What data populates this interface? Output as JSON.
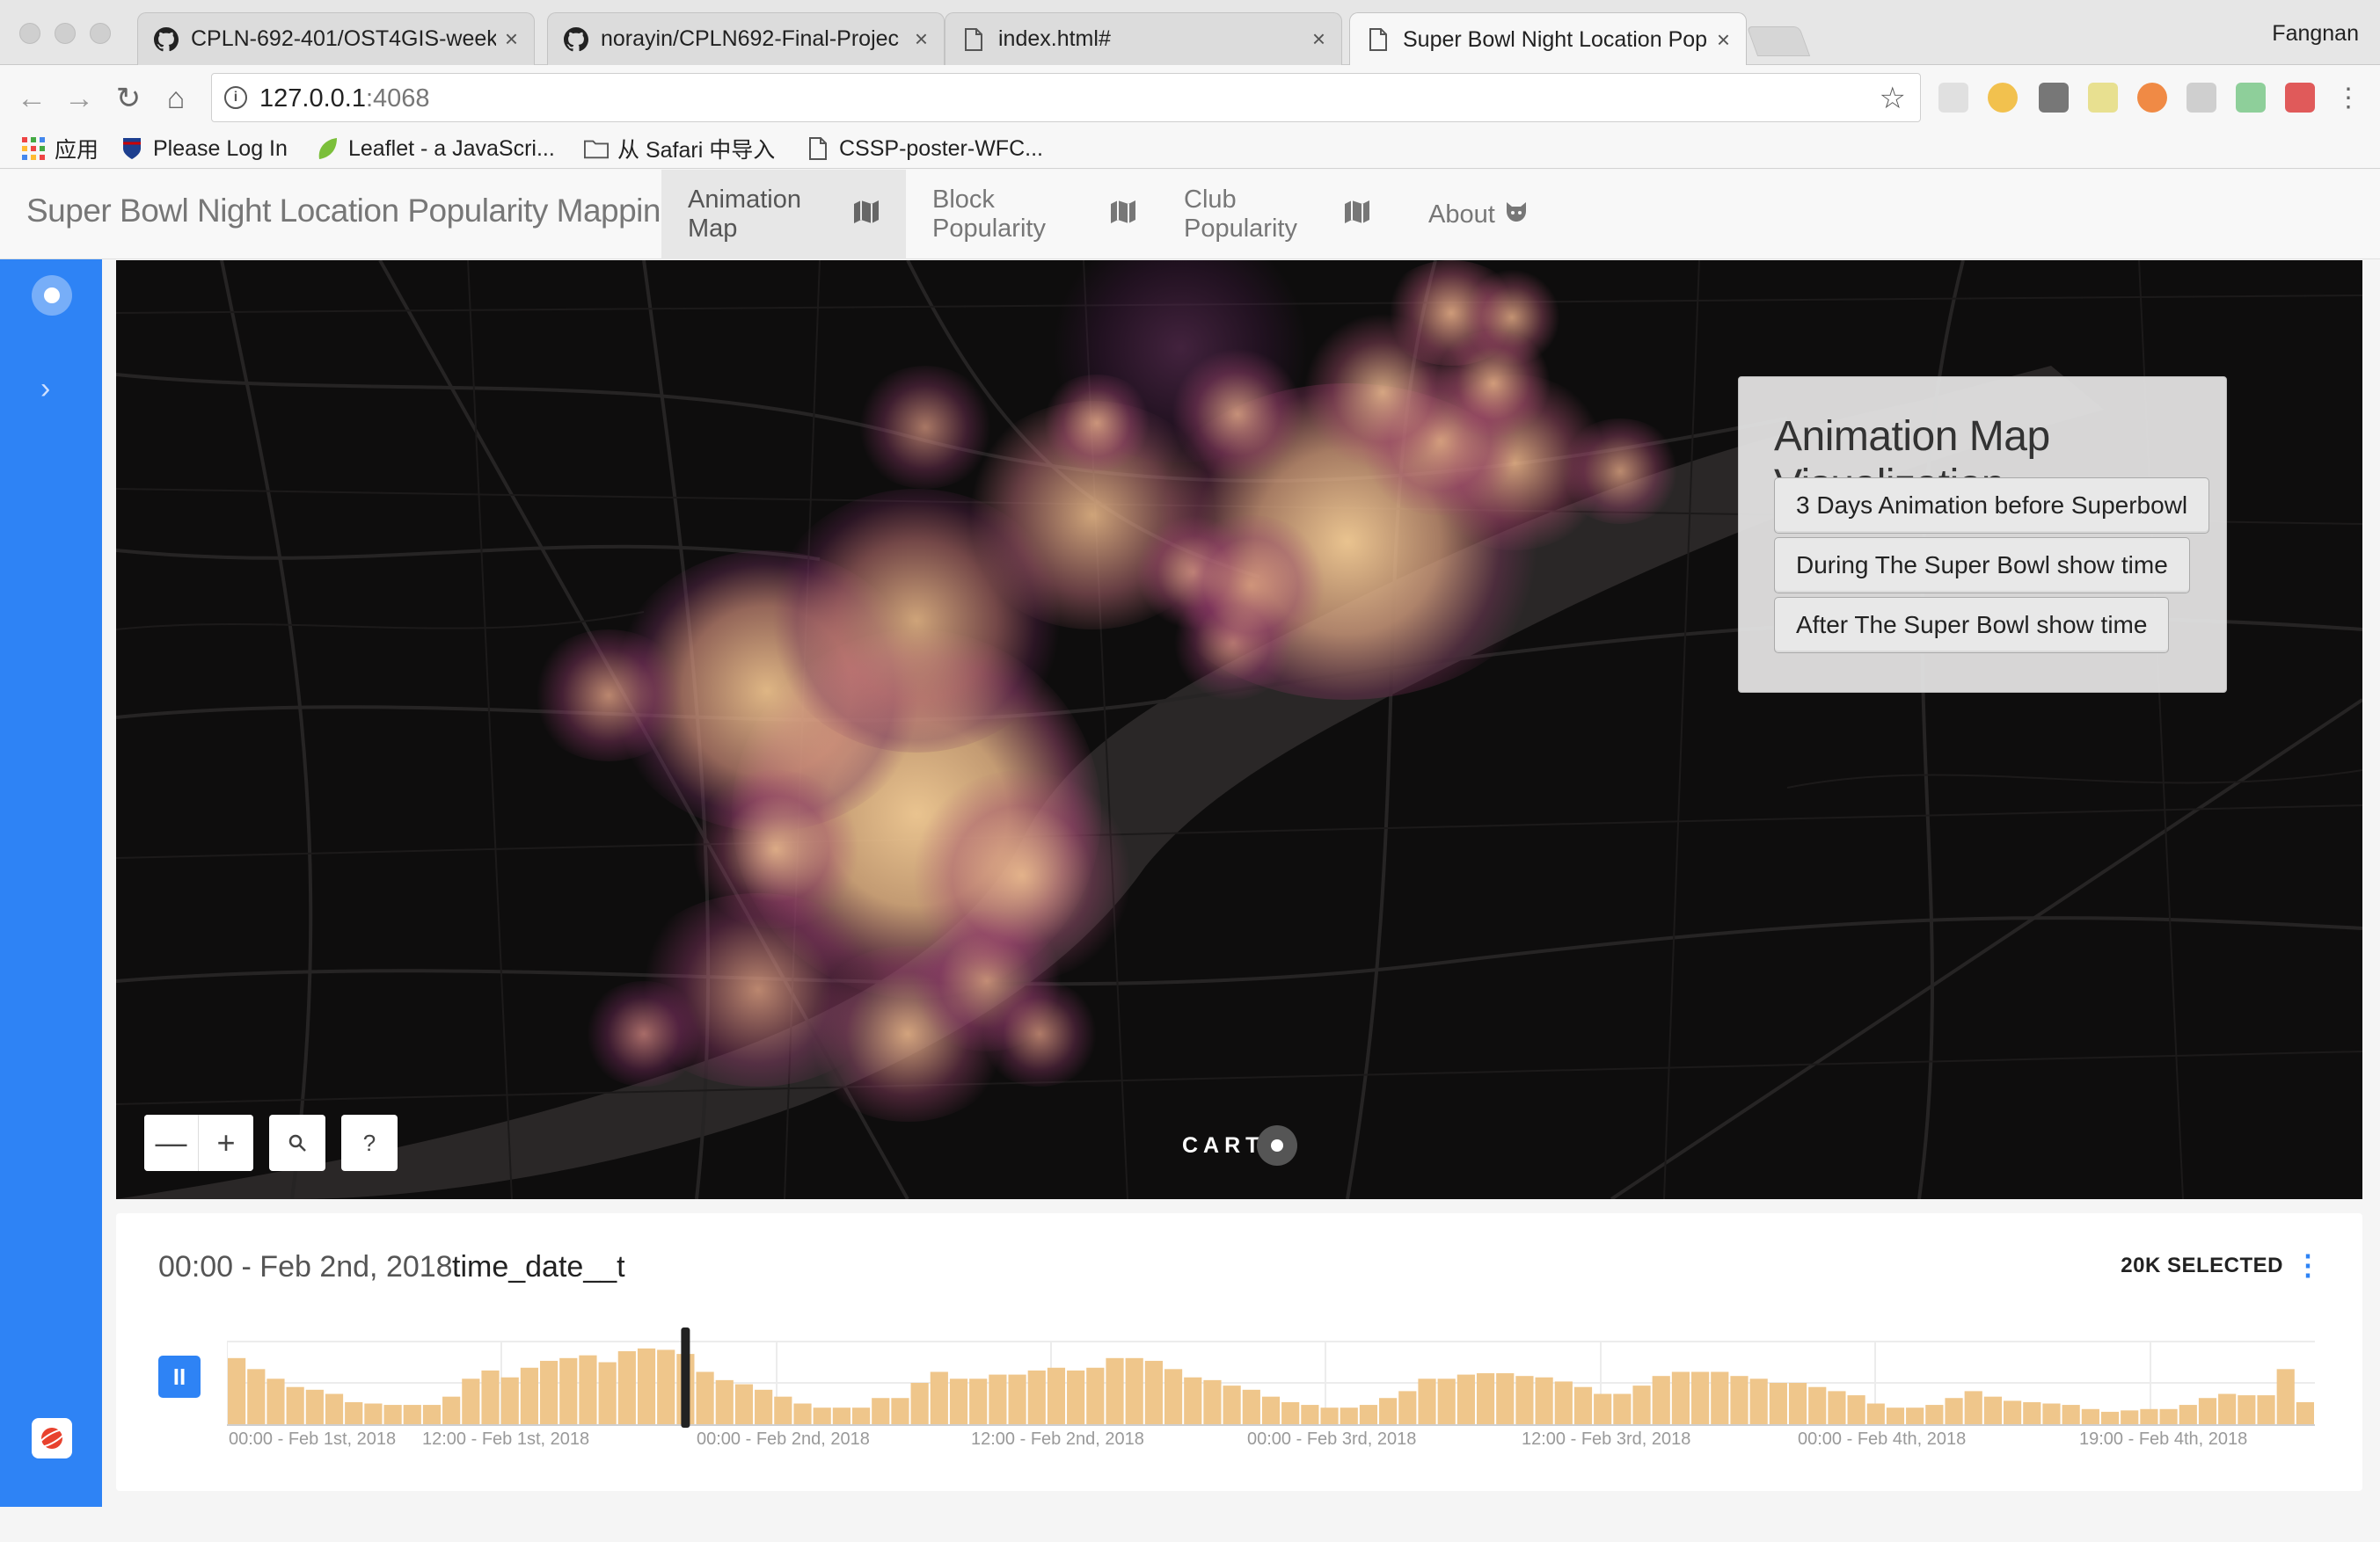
{
  "browser": {
    "tabs": [
      {
        "title": "CPLN-692-401/OST4GIS-week",
        "icon": "github-icon"
      },
      {
        "title": "norayin/CPLN692-Final-Projec",
        "icon": "github-icon"
      },
      {
        "title": "index.html#",
        "icon": "page-icon"
      },
      {
        "title": "Super Bowl Night Location Pop",
        "icon": "page-icon"
      }
    ],
    "close_glyph": "×",
    "profile_name": "Fangnan",
    "url_host": "127.0.0.1",
    "url_port": ":4068",
    "bookmarks": [
      {
        "label": "应用",
        "icon": "apps-grid-icon"
      },
      {
        "label": "Please Log In",
        "icon": "penn-shield-icon"
      },
      {
        "label": "Leaflet - a JavaScri...",
        "icon": "leaf-icon"
      },
      {
        "label": "从 Safari 中导入",
        "icon": "folder-icon"
      },
      {
        "label": "CSSP-poster-WFC...",
        "icon": "page-icon"
      }
    ]
  },
  "app": {
    "brand": "Super Bowl Night Location Popularity Mapping",
    "nav": [
      {
        "label": "Animation Map",
        "icon": "map-icon",
        "active": true
      },
      {
        "label": "Block Popularity",
        "icon": "map-icon",
        "active": false
      },
      {
        "label": "Club Popularity",
        "icon": "map-icon",
        "active": false
      },
      {
        "label": "About",
        "icon": "github-icon",
        "active": false
      }
    ]
  },
  "map": {
    "panel_title": "Animation Map Visualization",
    "buttons": [
      "3 Days Animation before Superbowl",
      "During The Super Bowl show time",
      "After The Super Bowl show time"
    ],
    "zoom_out": "—",
    "zoom_in": "+",
    "search": "⚲",
    "help": "?",
    "attribution": "CART"
  },
  "widget": {
    "title": "00:00 - Feb 2nd, 2018",
    "column": "time_date__t",
    "selected": "20K SELECTED",
    "menu": "⋮",
    "play": "II"
  },
  "chart_data": {
    "type": "bar",
    "x_ticks": [
      "00:00 - Feb 1st, 2018",
      "12:00 - Feb 1st, 2018",
      "00:00 - Feb 2nd, 2018",
      "12:00 - Feb 2nd, 2018",
      "00:00 - Feb 3rd, 2018",
      "12:00 - Feb 3rd, 2018",
      "00:00 - Feb 4th, 2018",
      "19:00 - Feb 4th, 2018"
    ],
    "values": [
      48,
      40,
      33,
      27,
      25,
      22,
      16,
      15,
      14,
      14,
      14,
      20,
      33,
      39,
      34,
      41,
      46,
      48,
      50,
      45,
      53,
      55,
      54,
      51,
      38,
      32,
      29,
      25,
      20,
      15,
      12,
      12,
      12,
      19,
      19,
      30,
      38,
      33,
      33,
      36,
      36,
      39,
      41,
      39,
      41,
      48,
      48,
      46,
      40,
      34,
      32,
      28,
      25,
      20,
      16,
      14,
      12,
      12,
      14,
      19,
      24,
      33,
      33,
      36,
      37,
      37,
      35,
      34,
      31,
      27,
      22,
      22,
      28,
      35,
      38,
      38,
      38,
      35,
      33,
      30,
      30,
      27,
      24,
      21,
      15,
      12,
      12,
      14,
      19,
      24,
      20,
      17,
      16,
      15,
      14,
      11,
      9,
      10,
      11,
      11,
      14,
      19,
      22,
      21,
      21,
      40,
      16
    ],
    "cursor_index": 23,
    "color": "#efc68b",
    "cursor_color": "#222222"
  }
}
